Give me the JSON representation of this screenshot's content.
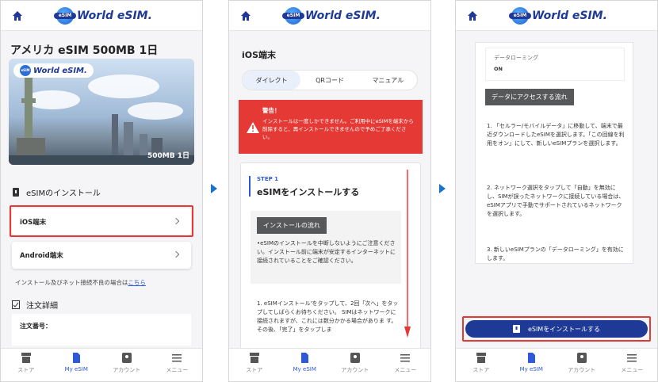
{
  "brand": {
    "name": "World eSIM.",
    "globe_text": "eSIM"
  },
  "tabbar": [
    {
      "label": "ストア"
    },
    {
      "label": "My eSIM"
    },
    {
      "label": "アカウント"
    },
    {
      "label": "メニュー"
    }
  ],
  "colors": {
    "accent": "#2e59d9",
    "navy": "#1e3a96",
    "warning": "#e53935",
    "arrow": "#1b73cf"
  },
  "panel1": {
    "title": "アメリカ eSIM 500MB 1日",
    "hero_plan": "500MB 1日",
    "install_section": "eSIMのインストール",
    "ios_label": "iOS端末",
    "android_label": "Android端末",
    "help_text": "インストール及びネット接続不良の場合は",
    "help_link": "こちら",
    "order_section": "注文詳細",
    "order_number_label": "注文番号："
  },
  "panel2": {
    "title": "iOS端末",
    "tabs": [
      "ダイレクト",
      "QRコード",
      "マニュアル"
    ],
    "warning_title": "警告！",
    "warning_body": "インストールは一度しかできません。ご利用中にeSIMを端末から削除すると、再インストールできませんので予めご了承ください。",
    "step_label": "STEP 1",
    "step_heading": "eSIMをインストールする",
    "flow_label": "インストールの流れ",
    "note": "•eSIMのインストールを中断しないようにご注意ください。インストール前に端末が安定するインターネットに接続されていることをご確認ください。",
    "step1_text": "1. eSIMインストール'をタップして、2回「次へ」をタップしてしばらくお待ちください。 SIMはネットワークに接続されますが、これには数分かかる場合がありま す。その後、「完了」をタップしま"
  },
  "panel3": {
    "roaming_label": "データローミング",
    "roaming_value": "ON",
    "access_label": "データにアクセスする流れ",
    "step1": "1. 「セルラー/モバイルデータ」に移動して、端末で最近ダウンロードしたeSIMを選択します。「この回線を利用をオン」にして、新しいeSIMプランを選択します。",
    "step2": "2. ネットワーク選択をタップして「自動」を無効にし、SIMが誤ったネットワークに接続している場合は、eSIMアプリで手動でサポートされているネットワークを選択します。",
    "step3": "3. 新しいeSIMプランの「データローミング」を有効にします。",
    "install_button": "eSIMをインストールする"
  }
}
